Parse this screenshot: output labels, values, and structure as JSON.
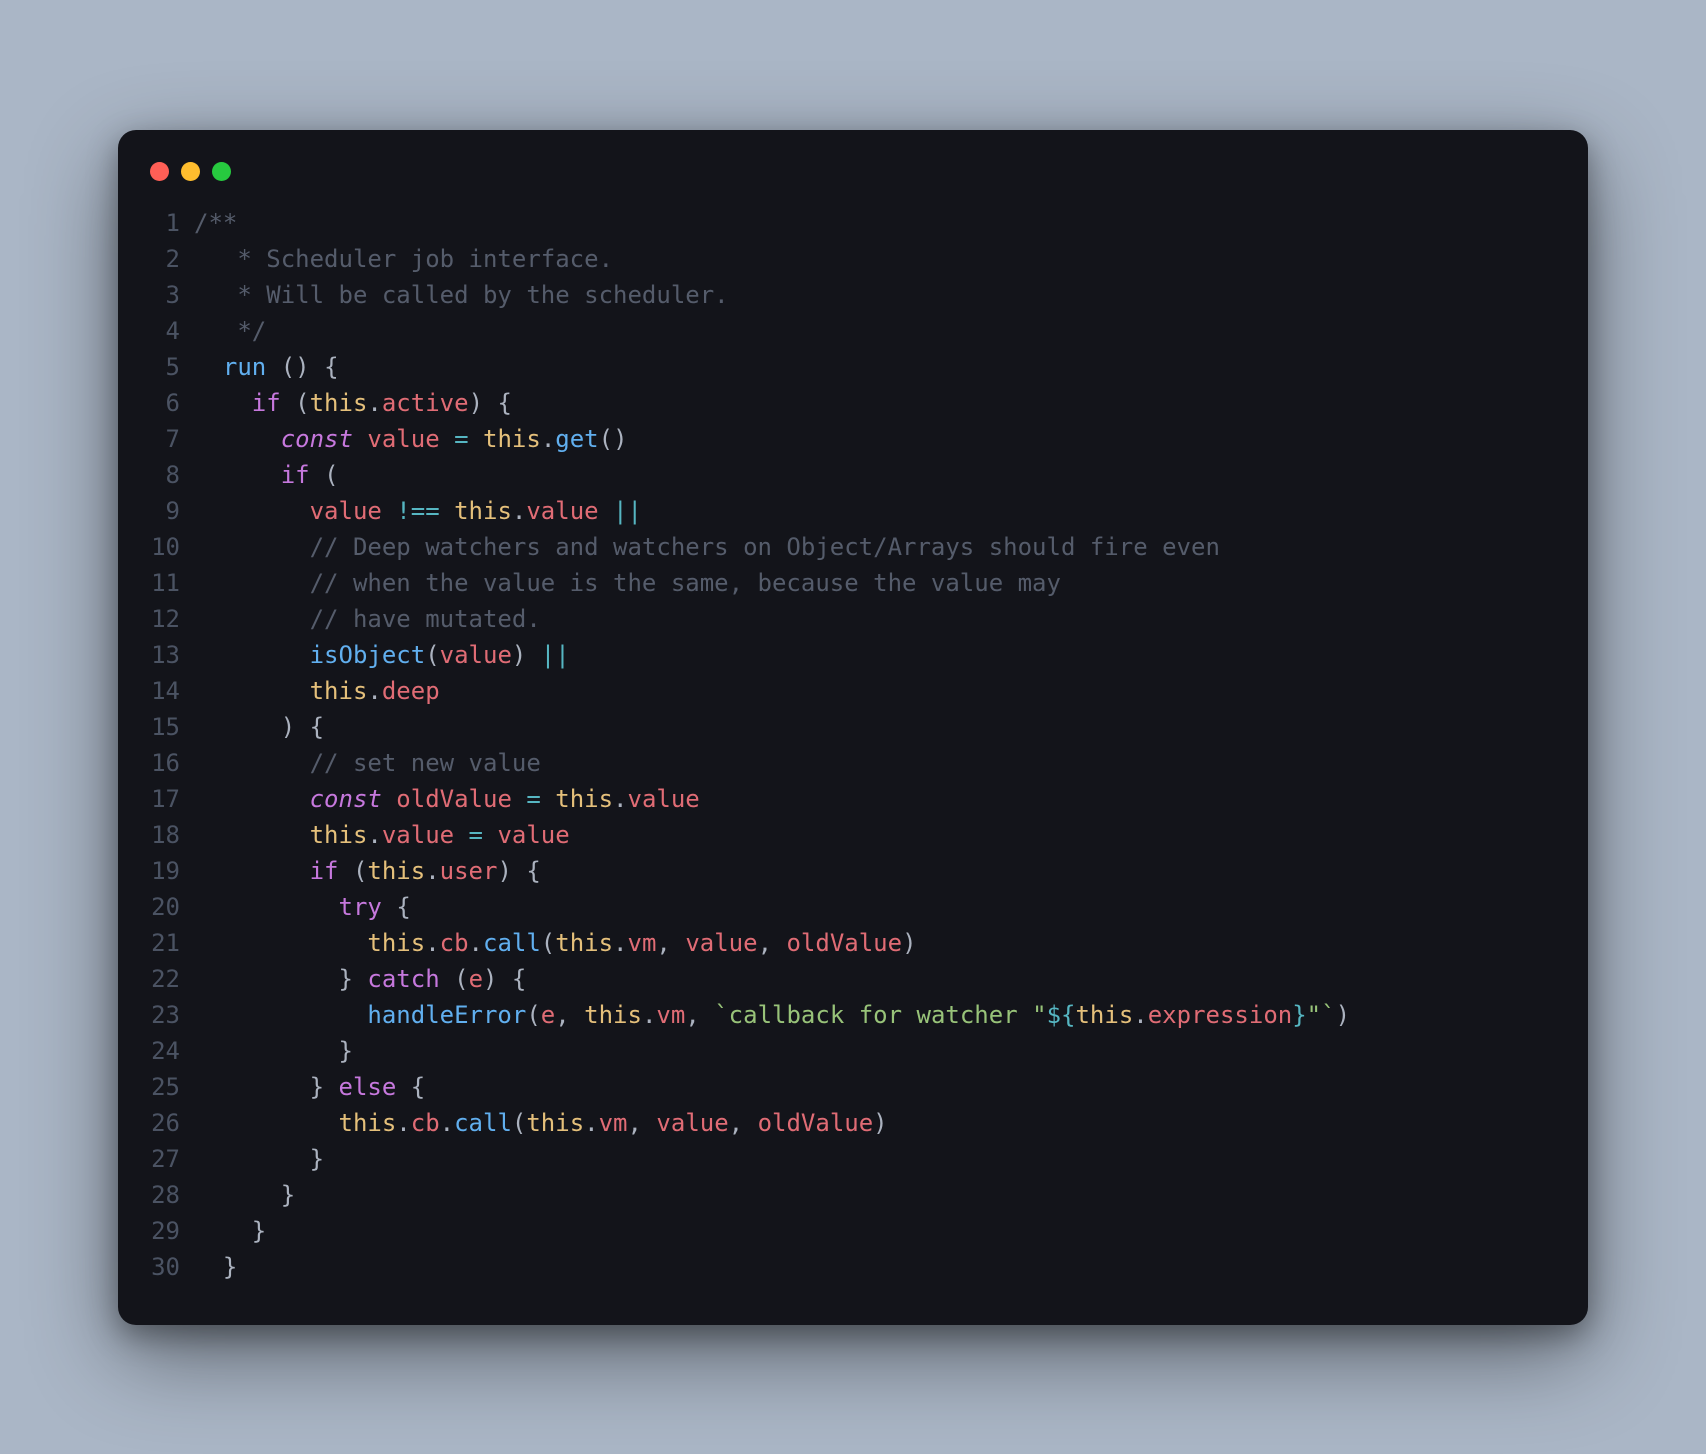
{
  "colors": {
    "window_bg": "#13141a",
    "page_bg": "#aab6c6",
    "gutter": "#4b5363",
    "comment": "#555c6b",
    "keyword": "#c678dd",
    "this": "#e5c07b",
    "prop": "#e06c75",
    "func": "#61afef",
    "op": "#56b6c2",
    "punc": "#abb2bf",
    "str": "#98c379",
    "traffic_red": "#ff5f56",
    "traffic_yellow": "#ffbd2e",
    "traffic_green": "#27c93f"
  },
  "code": {
    "line_count": 30,
    "lines": [
      {
        "n": 1,
        "tokens": [
          [
            "comment",
            "/**"
          ]
        ]
      },
      {
        "n": 2,
        "tokens": [
          [
            "comment",
            "   * Scheduler job interface."
          ]
        ]
      },
      {
        "n": 3,
        "tokens": [
          [
            "comment",
            "   * Will be called by the scheduler."
          ]
        ]
      },
      {
        "n": 4,
        "tokens": [
          [
            "comment",
            "   */"
          ]
        ]
      },
      {
        "n": 5,
        "tokens": [
          [
            "plain",
            "  "
          ],
          [
            "func",
            "run"
          ],
          [
            "plain",
            " "
          ],
          [
            "punc",
            "() {"
          ]
        ]
      },
      {
        "n": 6,
        "tokens": [
          [
            "plain",
            "    "
          ],
          [
            "keyword",
            "if"
          ],
          [
            "plain",
            " "
          ],
          [
            "punc",
            "("
          ],
          [
            "this",
            "this"
          ],
          [
            "punc",
            "."
          ],
          [
            "prop",
            "active"
          ],
          [
            "punc",
            ") {"
          ]
        ]
      },
      {
        "n": 7,
        "tokens": [
          [
            "plain",
            "      "
          ],
          [
            "keyword2",
            "const"
          ],
          [
            "plain",
            " "
          ],
          [
            "var",
            "value"
          ],
          [
            "plain",
            " "
          ],
          [
            "op",
            "="
          ],
          [
            "plain",
            " "
          ],
          [
            "this",
            "this"
          ],
          [
            "punc",
            "."
          ],
          [
            "func",
            "get"
          ],
          [
            "punc",
            "()"
          ]
        ]
      },
      {
        "n": 8,
        "tokens": [
          [
            "plain",
            "      "
          ],
          [
            "keyword",
            "if"
          ],
          [
            "plain",
            " "
          ],
          [
            "punc",
            "("
          ]
        ]
      },
      {
        "n": 9,
        "tokens": [
          [
            "plain",
            "        "
          ],
          [
            "var",
            "value"
          ],
          [
            "plain",
            " "
          ],
          [
            "op",
            "!=="
          ],
          [
            "plain",
            " "
          ],
          [
            "this",
            "this"
          ],
          [
            "punc",
            "."
          ],
          [
            "prop",
            "value"
          ],
          [
            "plain",
            " "
          ],
          [
            "op",
            "||"
          ]
        ]
      },
      {
        "n": 10,
        "tokens": [
          [
            "plain",
            "        "
          ],
          [
            "comment",
            "// Deep watchers and watchers on Object/Arrays should fire even"
          ]
        ]
      },
      {
        "n": 11,
        "tokens": [
          [
            "plain",
            "        "
          ],
          [
            "comment",
            "// when the value is the same, because the value may"
          ]
        ]
      },
      {
        "n": 12,
        "tokens": [
          [
            "plain",
            "        "
          ],
          [
            "comment",
            "// have mutated."
          ]
        ]
      },
      {
        "n": 13,
        "tokens": [
          [
            "plain",
            "        "
          ],
          [
            "func",
            "isObject"
          ],
          [
            "punc",
            "("
          ],
          [
            "var",
            "value"
          ],
          [
            "punc",
            ")"
          ],
          [
            "plain",
            " "
          ],
          [
            "op",
            "||"
          ]
        ]
      },
      {
        "n": 14,
        "tokens": [
          [
            "plain",
            "        "
          ],
          [
            "this",
            "this"
          ],
          [
            "punc",
            "."
          ],
          [
            "prop",
            "deep"
          ]
        ]
      },
      {
        "n": 15,
        "tokens": [
          [
            "plain",
            "      "
          ],
          [
            "punc",
            ") {"
          ]
        ]
      },
      {
        "n": 16,
        "tokens": [
          [
            "plain",
            "        "
          ],
          [
            "comment",
            "// set new value"
          ]
        ]
      },
      {
        "n": 17,
        "tokens": [
          [
            "plain",
            "        "
          ],
          [
            "keyword2",
            "const"
          ],
          [
            "plain",
            " "
          ],
          [
            "var",
            "oldValue"
          ],
          [
            "plain",
            " "
          ],
          [
            "op",
            "="
          ],
          [
            "plain",
            " "
          ],
          [
            "this",
            "this"
          ],
          [
            "punc",
            "."
          ],
          [
            "prop",
            "value"
          ]
        ]
      },
      {
        "n": 18,
        "tokens": [
          [
            "plain",
            "        "
          ],
          [
            "this",
            "this"
          ],
          [
            "punc",
            "."
          ],
          [
            "prop",
            "value"
          ],
          [
            "plain",
            " "
          ],
          [
            "op",
            "="
          ],
          [
            "plain",
            " "
          ],
          [
            "var",
            "value"
          ]
        ]
      },
      {
        "n": 19,
        "tokens": [
          [
            "plain",
            "        "
          ],
          [
            "keyword",
            "if"
          ],
          [
            "plain",
            " "
          ],
          [
            "punc",
            "("
          ],
          [
            "this",
            "this"
          ],
          [
            "punc",
            "."
          ],
          [
            "prop",
            "user"
          ],
          [
            "punc",
            ") {"
          ]
        ]
      },
      {
        "n": 20,
        "tokens": [
          [
            "plain",
            "          "
          ],
          [
            "keyword",
            "try"
          ],
          [
            "plain",
            " "
          ],
          [
            "punc",
            "{"
          ]
        ]
      },
      {
        "n": 21,
        "tokens": [
          [
            "plain",
            "            "
          ],
          [
            "this",
            "this"
          ],
          [
            "punc",
            "."
          ],
          [
            "prop",
            "cb"
          ],
          [
            "punc",
            "."
          ],
          [
            "func",
            "call"
          ],
          [
            "punc",
            "("
          ],
          [
            "this",
            "this"
          ],
          [
            "punc",
            "."
          ],
          [
            "prop",
            "vm"
          ],
          [
            "punc",
            ", "
          ],
          [
            "var",
            "value"
          ],
          [
            "punc",
            ", "
          ],
          [
            "var",
            "oldValue"
          ],
          [
            "punc",
            ")"
          ]
        ]
      },
      {
        "n": 22,
        "tokens": [
          [
            "plain",
            "          "
          ],
          [
            "punc",
            "} "
          ],
          [
            "keyword",
            "catch"
          ],
          [
            "plain",
            " "
          ],
          [
            "punc",
            "("
          ],
          [
            "var",
            "e"
          ],
          [
            "punc",
            ") {"
          ]
        ]
      },
      {
        "n": 23,
        "tokens": [
          [
            "plain",
            "            "
          ],
          [
            "func",
            "handleError"
          ],
          [
            "punc",
            "("
          ],
          [
            "var",
            "e"
          ],
          [
            "punc",
            ", "
          ],
          [
            "this",
            "this"
          ],
          [
            "punc",
            "."
          ],
          [
            "prop",
            "vm"
          ],
          [
            "punc",
            ", "
          ],
          [
            "str",
            "`callback for watcher \""
          ],
          [
            "op",
            "${"
          ],
          [
            "this",
            "this"
          ],
          [
            "punc",
            "."
          ],
          [
            "tmpl",
            "expression"
          ],
          [
            "op",
            "}"
          ],
          [
            "str",
            "\"`"
          ],
          [
            "punc",
            ")"
          ]
        ]
      },
      {
        "n": 24,
        "tokens": [
          [
            "plain",
            "          "
          ],
          [
            "punc",
            "}"
          ]
        ]
      },
      {
        "n": 25,
        "tokens": [
          [
            "plain",
            "        "
          ],
          [
            "punc",
            "} "
          ],
          [
            "keyword",
            "else"
          ],
          [
            "plain",
            " "
          ],
          [
            "punc",
            "{"
          ]
        ]
      },
      {
        "n": 26,
        "tokens": [
          [
            "plain",
            "          "
          ],
          [
            "this",
            "this"
          ],
          [
            "punc",
            "."
          ],
          [
            "prop",
            "cb"
          ],
          [
            "punc",
            "."
          ],
          [
            "func",
            "call"
          ],
          [
            "punc",
            "("
          ],
          [
            "this",
            "this"
          ],
          [
            "punc",
            "."
          ],
          [
            "prop",
            "vm"
          ],
          [
            "punc",
            ", "
          ],
          [
            "var",
            "value"
          ],
          [
            "punc",
            ", "
          ],
          [
            "var",
            "oldValue"
          ],
          [
            "punc",
            ")"
          ]
        ]
      },
      {
        "n": 27,
        "tokens": [
          [
            "plain",
            "        "
          ],
          [
            "punc",
            "}"
          ]
        ]
      },
      {
        "n": 28,
        "tokens": [
          [
            "plain",
            "      "
          ],
          [
            "punc",
            "}"
          ]
        ]
      },
      {
        "n": 29,
        "tokens": [
          [
            "plain",
            "    "
          ],
          [
            "punc",
            "}"
          ]
        ]
      },
      {
        "n": 30,
        "tokens": [
          [
            "plain",
            "  "
          ],
          [
            "punc",
            "}"
          ]
        ]
      }
    ]
  }
}
